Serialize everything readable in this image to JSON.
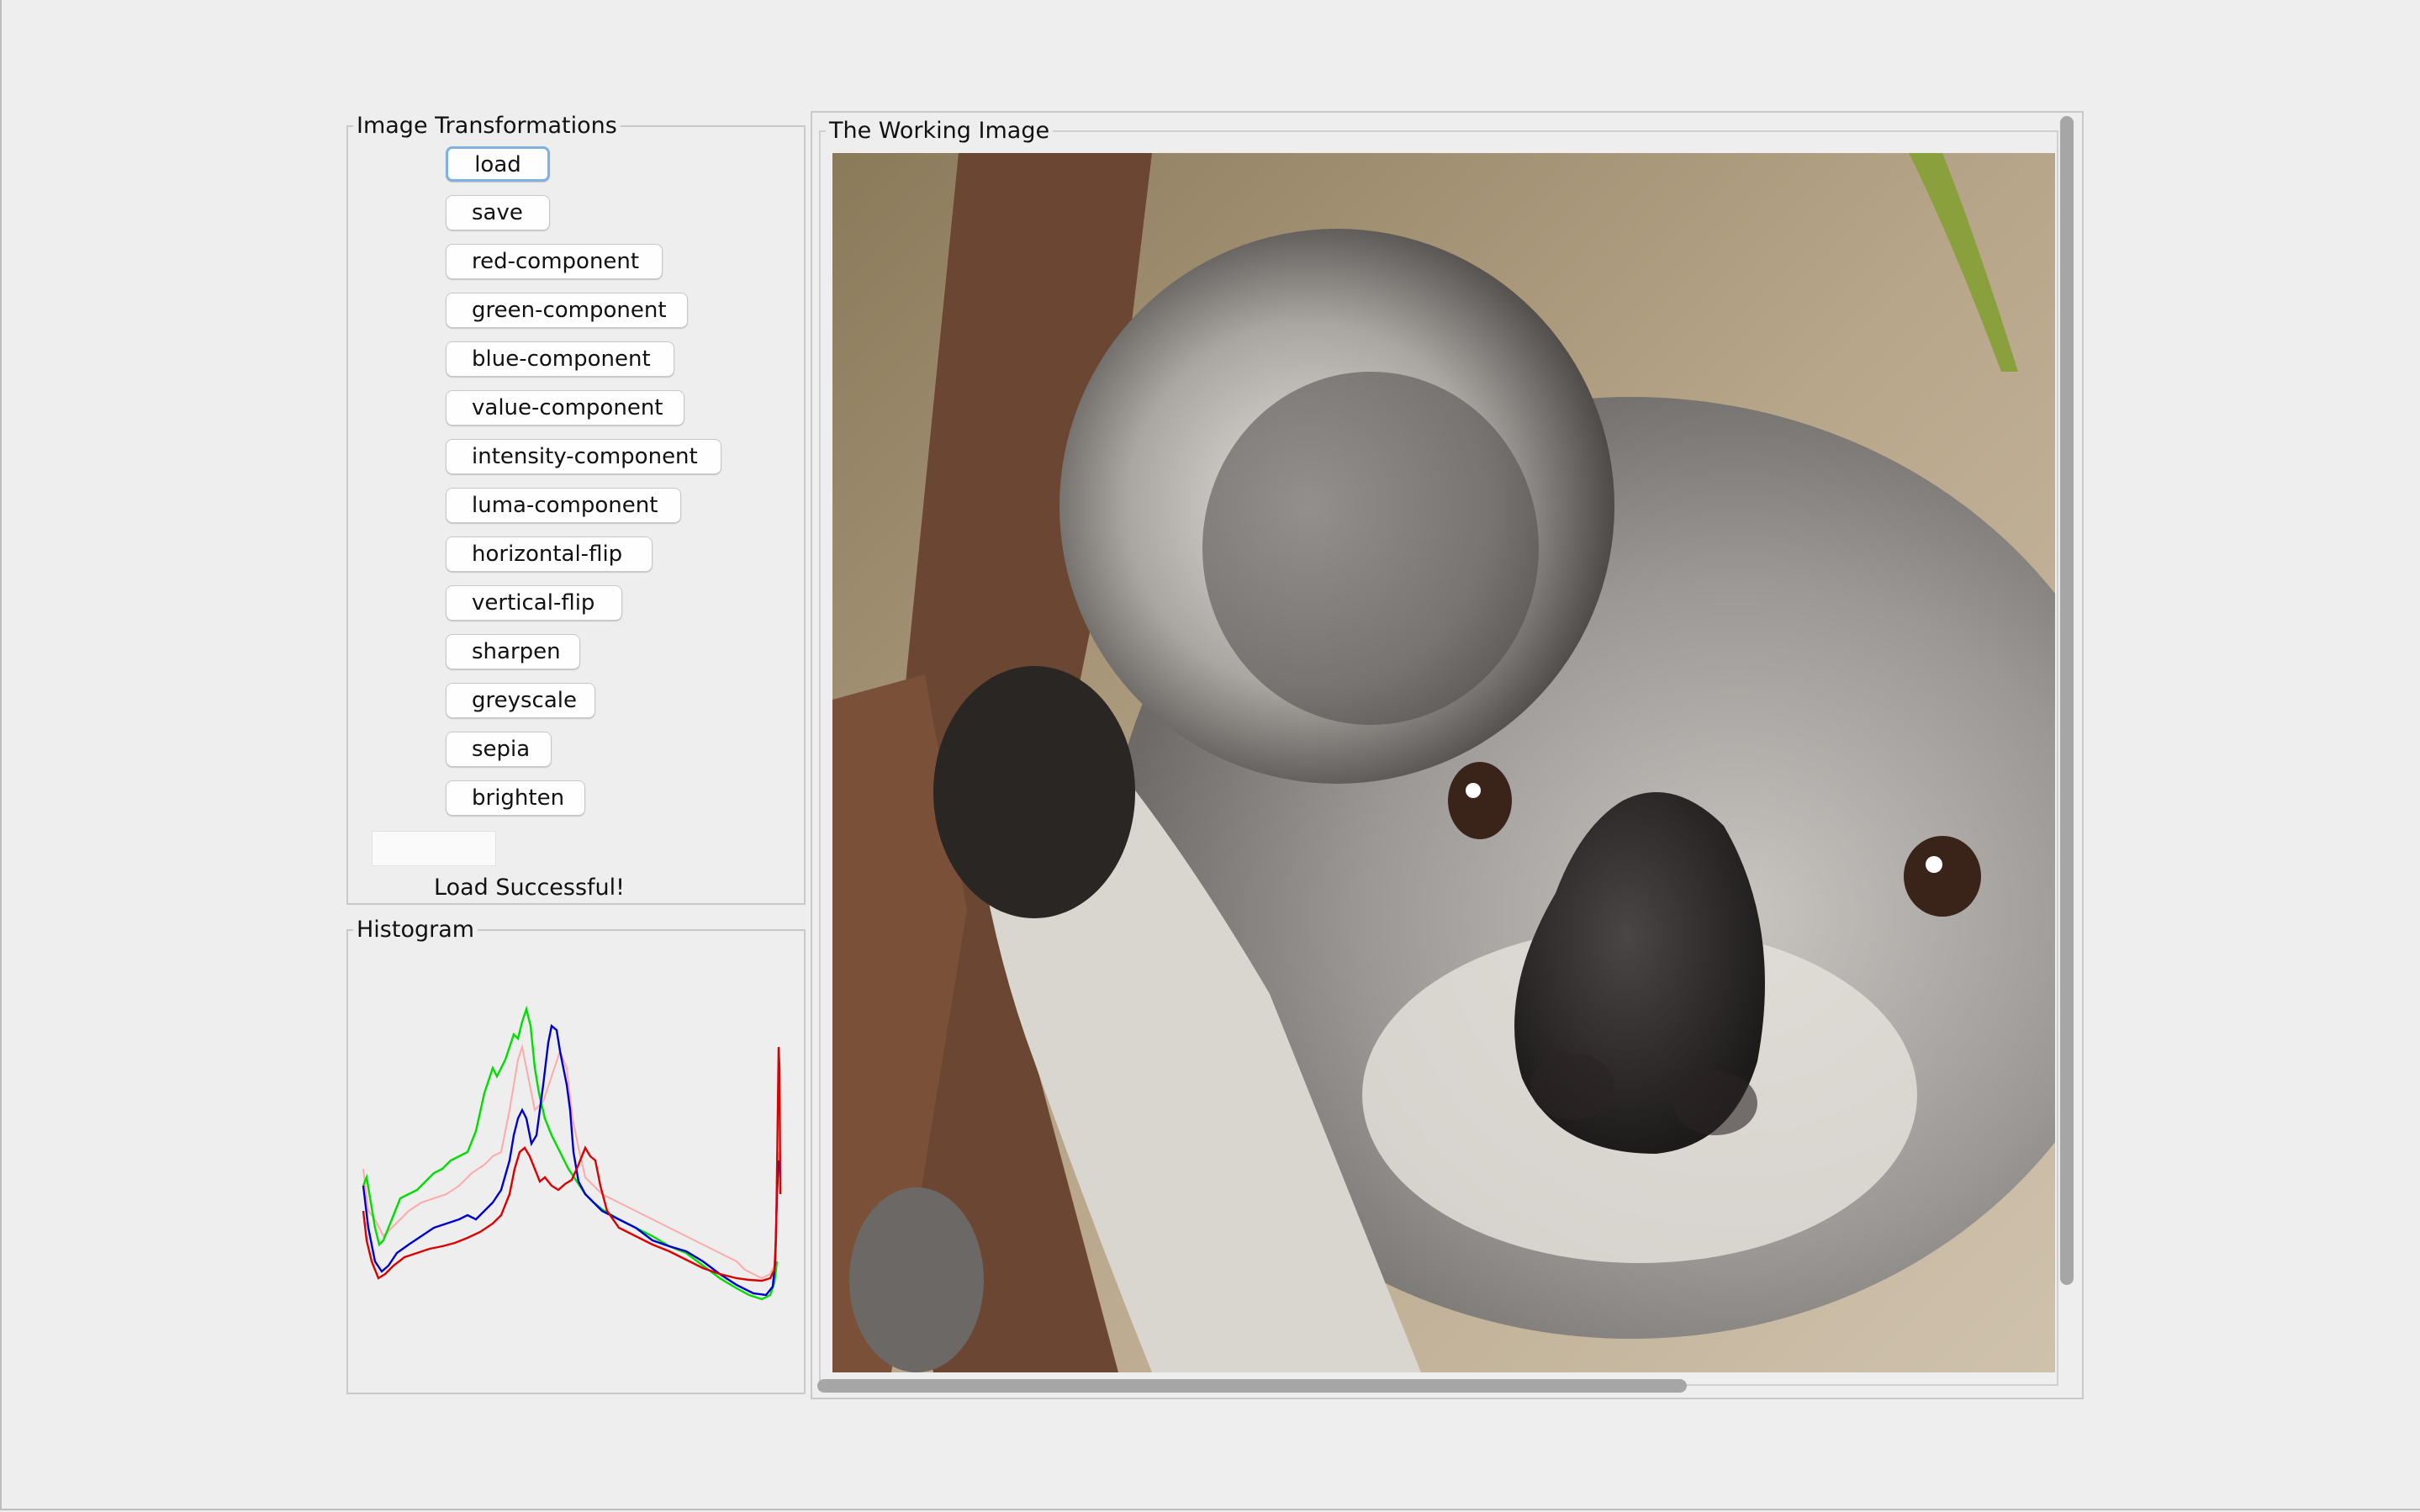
{
  "transform_panel": {
    "title": "Image Transformations",
    "buttons": [
      {
        "label": "load"
      },
      {
        "label": "save"
      },
      {
        "label": "red-component"
      },
      {
        "label": "green-component"
      },
      {
        "label": "blue-component"
      },
      {
        "label": "value-component"
      },
      {
        "label": "intensity-component"
      },
      {
        "label": "luma-component"
      },
      {
        "label": "horizontal-flip"
      },
      {
        "label": "vertical-flip"
      },
      {
        "label": "sharpen"
      },
      {
        "label": "greyscale"
      },
      {
        "label": "sepia"
      },
      {
        "label": "brighten"
      }
    ],
    "brighten_input_value": "",
    "status_message": "Load Successful!"
  },
  "histogram_panel": {
    "title": "Histogram",
    "series_colors": {
      "red": "#e00000",
      "green": "#00e000",
      "blue": "#0000d0",
      "intensity": "#ffaaaa"
    }
  },
  "image_panel": {
    "title": "The Working Image",
    "image_subject": "koala"
  },
  "colors": {
    "background": "#eeeeee",
    "focus_ring": "#7fb1e3",
    "scrollbar": "#a6a6a6"
  }
}
